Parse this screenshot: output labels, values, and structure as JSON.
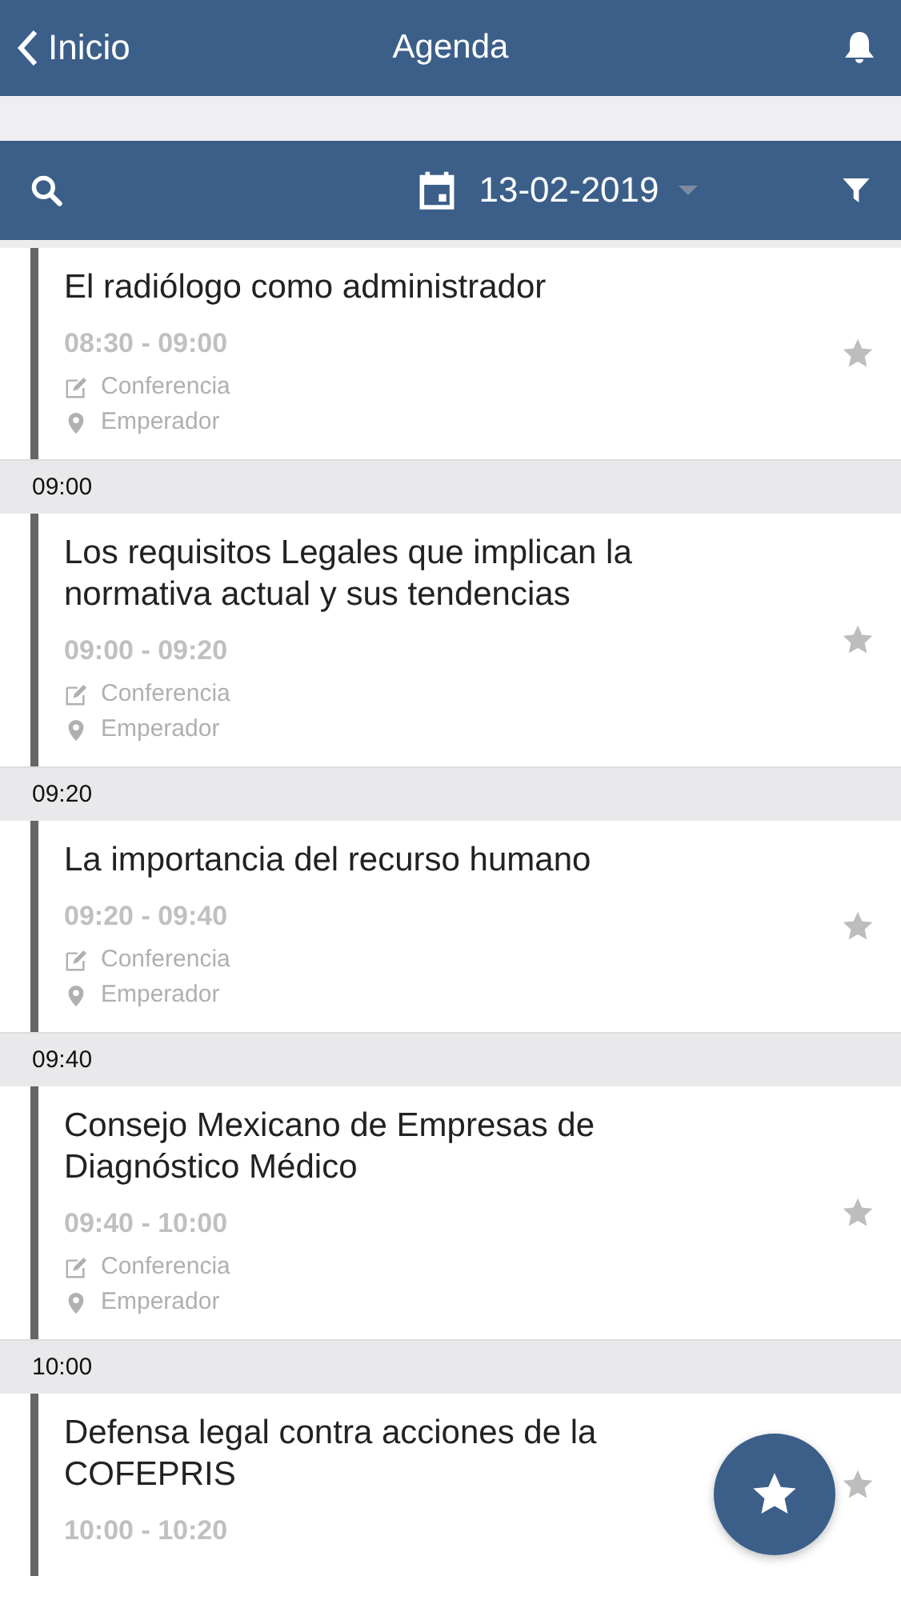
{
  "header": {
    "back": "Inicio",
    "title": "Agenda"
  },
  "toolbar": {
    "date": "13-02-2019"
  },
  "entries": [
    {
      "kind": "session",
      "title": "El radiólogo como administrador",
      "time": "08:30 - 09:00",
      "type": "Conferencia",
      "location": "Emperador",
      "favorite": false
    },
    {
      "kind": "time_header",
      "label": "09:00"
    },
    {
      "kind": "session",
      "title": "Los requisitos Legales que implican la normativa actual y sus tendencias",
      "time": "09:00 - 09:20",
      "type": "Conferencia",
      "location": "Emperador",
      "favorite": false
    },
    {
      "kind": "time_header",
      "label": "09:20"
    },
    {
      "kind": "session",
      "title": "La importancia del recurso humano",
      "time": "09:20 - 09:40",
      "type": "Conferencia",
      "location": "Emperador",
      "favorite": false
    },
    {
      "kind": "time_header",
      "label": "09:40"
    },
    {
      "kind": "session",
      "title": "Consejo Mexicano de Empresas de Diagnóstico Médico",
      "time": "09:40 - 10:00",
      "type": "Conferencia",
      "location": "Emperador",
      "favorite": false
    },
    {
      "kind": "time_header",
      "label": "10:00"
    },
    {
      "kind": "session",
      "title": "Defensa legal contra acciones de la COFEPRIS",
      "time": "10:00 - 10:20",
      "favorite": false
    }
  ]
}
